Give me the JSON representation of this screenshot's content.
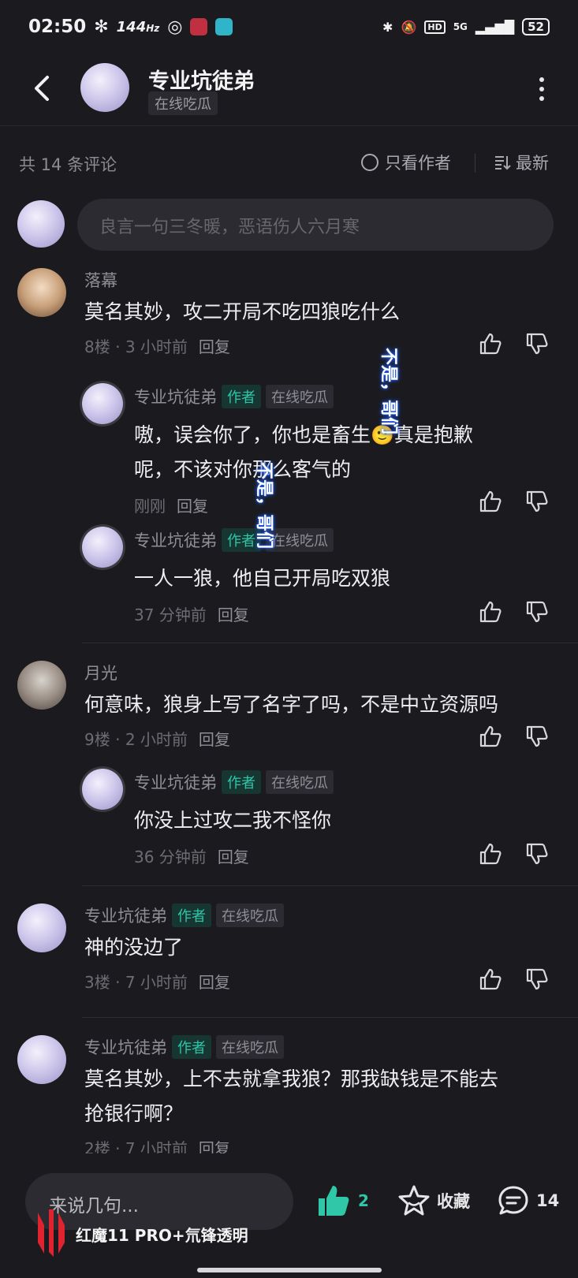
{
  "status_bar": {
    "time": "02:50",
    "refresh_rate": "144",
    "refresh_unit": "Hz",
    "network": "5G",
    "battery": "52"
  },
  "header": {
    "title": "专业坑徒弟",
    "tag": "在线吃瓜"
  },
  "sort_bar": {
    "count_text": "共 14 条评论",
    "author_only": "只看作者",
    "latest": "最新"
  },
  "compose": {
    "placeholder": "良言一句三冬暖，恶语伤人六月寒"
  },
  "badges": {
    "author": "作者",
    "online": "在线吃瓜"
  },
  "comments": [
    {
      "user": "落幕",
      "text": "莫名其妙，攻二开局不吃四狼吃什么",
      "floor": "8楼",
      "time": "3 小时前",
      "reply": "回复",
      "replies": [
        {
          "user": "专业坑徒弟",
          "text_line1": "嗷，误会你了，你也是畜生",
          "emoji": "🙂",
          "text_line1b": "真是抱歉",
          "text_line2": "呢，不该对你那么客气的",
          "time": "刚刚",
          "reply": "回复"
        },
        {
          "user": "专业坑徒弟",
          "text": "一人一狼，他自己开局吃双狼",
          "time": "37 分钟前",
          "reply": "回复"
        }
      ]
    },
    {
      "user": "月光",
      "text": "何意味，狼身上写了名字了吗，不是中立资源吗",
      "floor": "9楼",
      "time": "2 小时前",
      "reply": "回复",
      "replies": [
        {
          "user": "专业坑徒弟",
          "text": "你没上过攻二我不怪你",
          "time": "36 分钟前",
          "reply": "回复"
        }
      ]
    },
    {
      "user": "专业坑徒弟",
      "text": "神的没边了",
      "floor": "3楼",
      "time": "7 小时前",
      "reply": "回复"
    },
    {
      "user": "专业坑徒弟",
      "text_line1": "莫名其妙，上不去就拿我狼？那我缺钱是不能去",
      "text_line2": "抢银行啊？",
      "floor": "2楼",
      "time": "7 小时前",
      "reply": "回复"
    }
  ],
  "overlay": {
    "text": "不是，哥们"
  },
  "bottom_bar": {
    "input_placeholder": "来说几句...",
    "like_count": "2",
    "favorite_label": "收藏",
    "comment_count": "14",
    "watermark": "红魔11 PRO+氘锋透明"
  },
  "colors": {
    "background": "#1b1b1f",
    "accent": "#2fc7a8",
    "text_primary": "#eeeef0",
    "text_secondary": "#8e8e96"
  }
}
